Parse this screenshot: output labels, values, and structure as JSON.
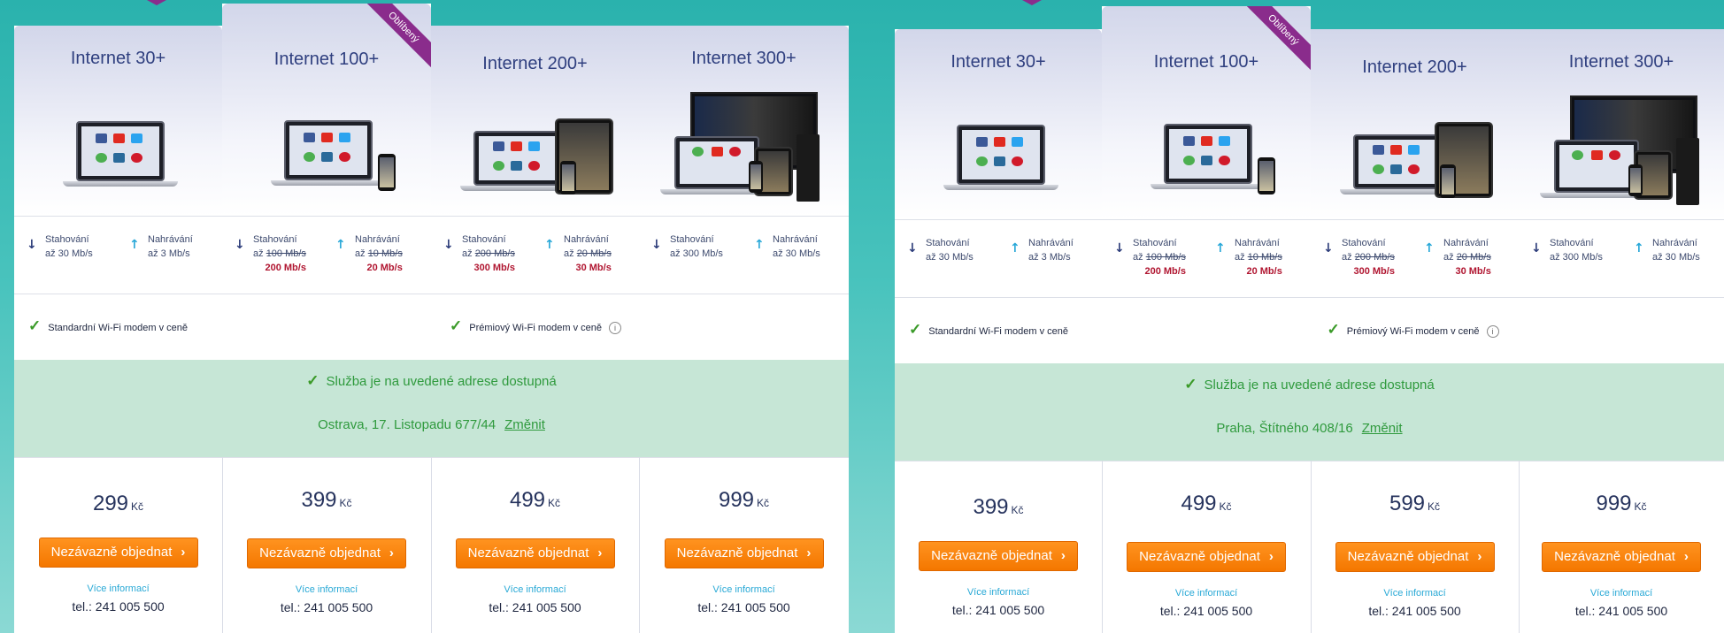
{
  "panels": [
    {
      "availability": {
        "status": "Služba je na uvedené adrese dostupná",
        "address": "Ostrava, 17. Listopadu 677/44",
        "change_label": "Změnit"
      },
      "plans": [
        {
          "title": "Internet 30+",
          "download_label": "Stahování",
          "download_old": "až 30 Mb/s",
          "upload_label": "Nahrávání",
          "upload_old": "až 3 Mb/s",
          "price": "299",
          "currency": "Kč"
        },
        {
          "title": "Internet 100+",
          "ribbon": "Oblíbený",
          "download_label": "Stahování",
          "download_prefix": "až",
          "download_old": "100 Mb/s",
          "download_new": "200 Mb/s",
          "upload_label": "Nahrávání",
          "upload_prefix": "až",
          "upload_old": "10 Mb/s",
          "upload_new": "20 Mb/s",
          "price": "399",
          "currency": "Kč"
        },
        {
          "title": "Internet 200+",
          "download_label": "Stahování",
          "download_prefix": "až",
          "download_old": "200 Mb/s",
          "download_new": "300 Mb/s",
          "upload_label": "Nahrávání",
          "upload_prefix": "až",
          "upload_old": "20 Mb/s",
          "upload_new": "30 Mb/s",
          "price": "499",
          "currency": "Kč"
        },
        {
          "title": "Internet 300+",
          "download_label": "Stahování",
          "download_old": "až 300 Mb/s",
          "upload_label": "Nahrávání",
          "upload_old": "až 30 Mb/s",
          "price": "999",
          "currency": "Kč"
        }
      ],
      "modem_standard": "Standardní Wi-Fi modem v ceně",
      "modem_premium": "Prémiový Wi-Fi modem v ceně"
    },
    {
      "availability": {
        "status": "Služba je na uvedené adrese dostupná",
        "address": "Praha, Štítného 408/16",
        "change_label": "Změnit"
      },
      "plans": [
        {
          "title": "Internet 30+",
          "download_label": "Stahování",
          "download_old": "až 30 Mb/s",
          "upload_label": "Nahrávání",
          "upload_old": "až 3 Mb/s",
          "price": "399",
          "currency": "Kč"
        },
        {
          "title": "Internet 100+",
          "ribbon": "Oblíbený",
          "download_label": "Stahování",
          "download_prefix": "až",
          "download_old": "100 Mb/s",
          "download_new": "200 Mb/s",
          "upload_label": "Nahrávání",
          "upload_prefix": "až",
          "upload_old": "10 Mb/s",
          "upload_new": "20 Mb/s",
          "price": "499",
          "currency": "Kč"
        },
        {
          "title": "Internet 200+",
          "download_label": "Stahování",
          "download_prefix": "až",
          "download_old": "200 Mb/s",
          "download_new": "300 Mb/s",
          "upload_label": "Nahrávání",
          "upload_prefix": "až",
          "upload_old": "20 Mb/s",
          "upload_new": "30 Mb/s",
          "price": "599",
          "currency": "Kč"
        },
        {
          "title": "Internet 300+",
          "download_label": "Stahování",
          "download_old": "až 300 Mb/s",
          "upload_label": "Nahrávání",
          "upload_old": "až 30 Mb/s",
          "price": "999",
          "currency": "Kč"
        }
      ],
      "modem_standard": "Standardní Wi-Fi modem v ceně",
      "modem_premium": "Prémiový Wi-Fi modem v ceně"
    }
  ],
  "common": {
    "order_label": "Nezávazně objednat",
    "more_info": "Více informací",
    "phone": "tel.: 241 005 500"
  },
  "icons": {
    "download": "arrow-down-icon",
    "upload": "arrow-up-icon",
    "check": "checkmark-icon",
    "info": "info-icon",
    "chevron": "chevron-right-icon"
  },
  "colors": {
    "accent_orange": "#f47700",
    "ribbon_purple": "#8a2c8c",
    "title_navy": "#2f3f7f",
    "new_speed_red": "#b01530",
    "available_green": "#2f9a3d",
    "available_bg": "#c6e6d6"
  }
}
